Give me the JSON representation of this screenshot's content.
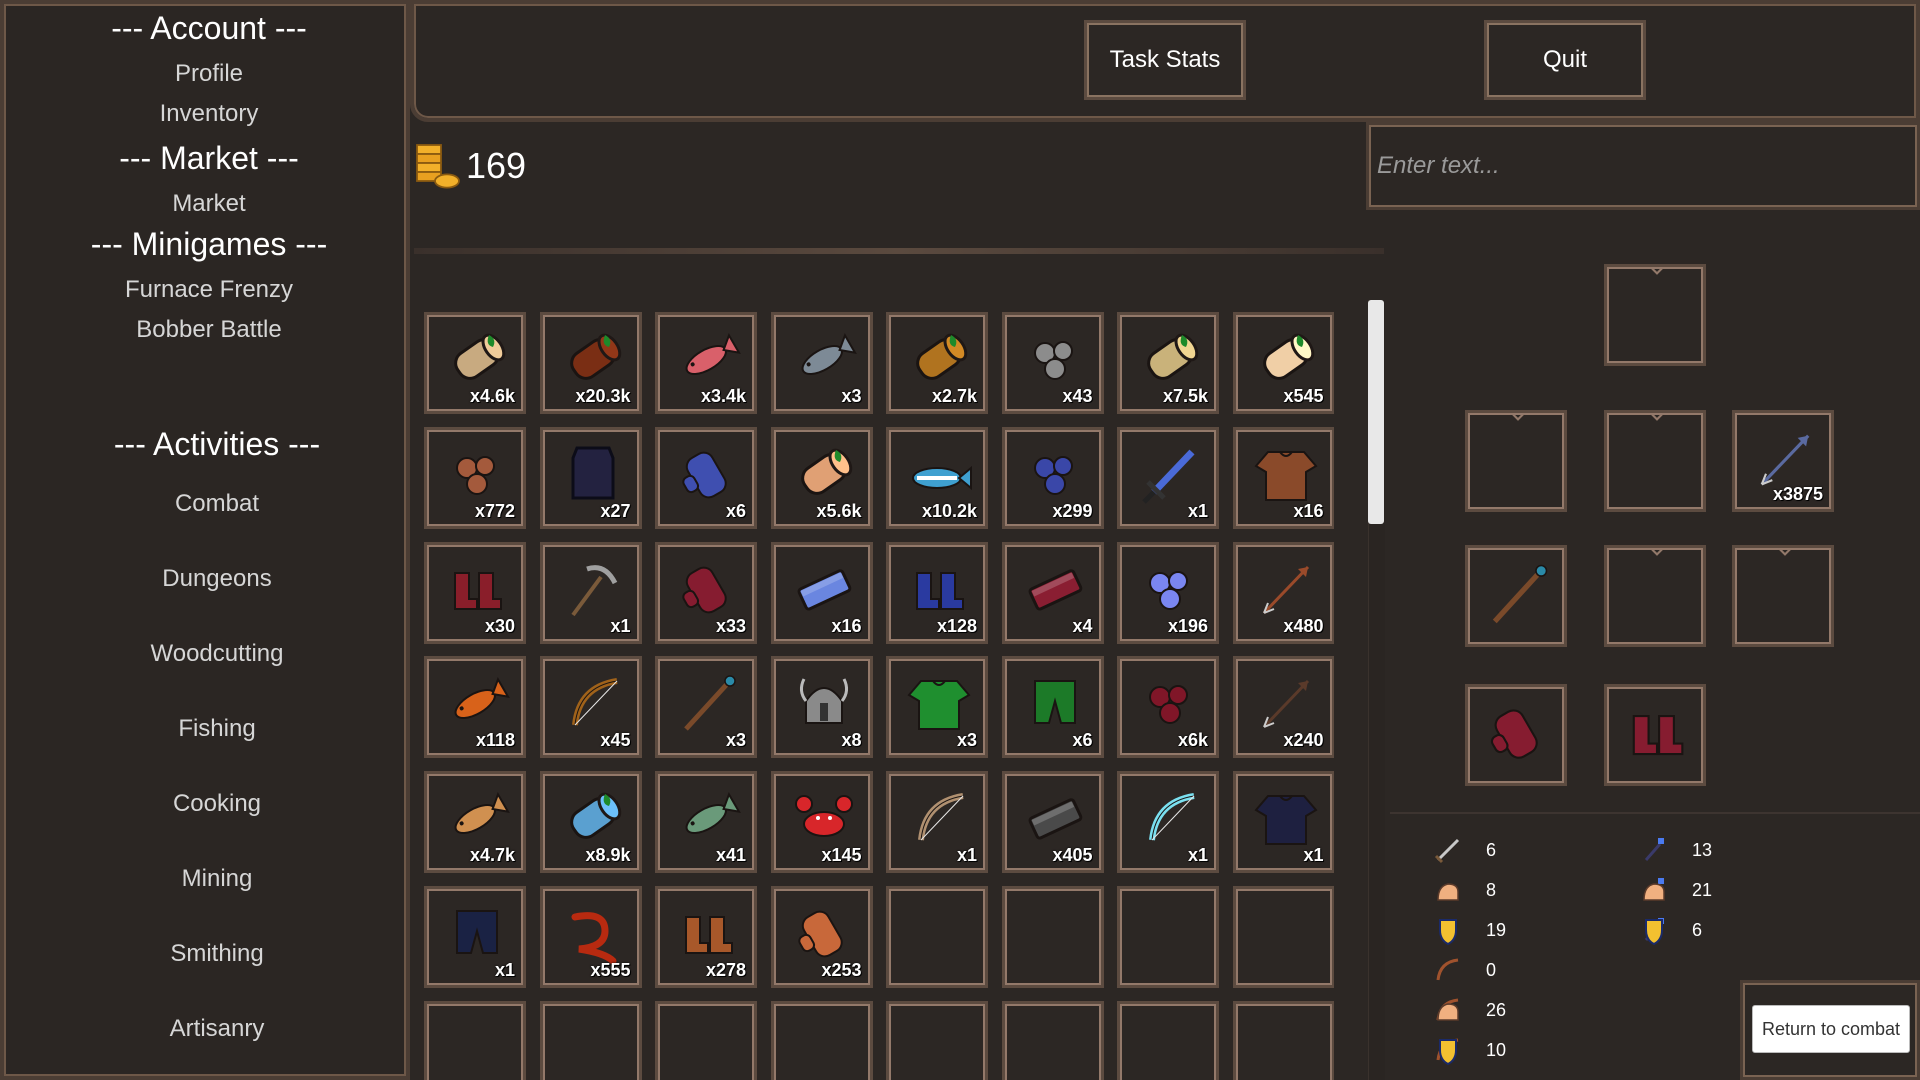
{
  "sidebar": {
    "account_header": "--- Account ---",
    "profile": "Profile",
    "inventory": "Inventory",
    "market_header": "--- Market ---",
    "market": "Market",
    "minigames_header": "--- Minigames ---",
    "furnace": "Furnace Frenzy",
    "bobber": "Bobber Battle",
    "activities_header": "--- Activities ---",
    "activities": [
      "Combat",
      "Dungeons",
      "Woodcutting",
      "Fishing",
      "Cooking",
      "Mining",
      "Smithing",
      "Artisanry"
    ]
  },
  "topbar": {
    "task_stats": "Task Stats",
    "quit": "Quit"
  },
  "gold": "169",
  "chat_placeholder": "Enter text...",
  "inventory": [
    {
      "icon": "birch-log-icon",
      "qty": "x4.6k",
      "color": "#c8aa80"
    },
    {
      "icon": "mahogany-log-icon",
      "qty": "x20.3k",
      "color": "#7a2e14"
    },
    {
      "icon": "pink-fish-icon",
      "qty": "x3.4k",
      "color": "#d9606a"
    },
    {
      "icon": "grey-fish-icon",
      "qty": "x3",
      "color": "#7d8a96"
    },
    {
      "icon": "oak-log-icon",
      "qty": "x2.7k",
      "color": "#b0731f"
    },
    {
      "icon": "stone-ore-icon",
      "qty": "x43",
      "color": "#8c8c8c"
    },
    {
      "icon": "pale-log-icon",
      "qty": "x7.5k",
      "color": "#c9b27a"
    },
    {
      "icon": "cream-log-icon",
      "qty": "x545",
      "color": "#f0cfa6"
    },
    {
      "icon": "copper-ore-icon",
      "qty": "x772",
      "color": "#a45a3c"
    },
    {
      "icon": "dark-body-armor-icon",
      "qty": "x27",
      "color": "#232240"
    },
    {
      "icon": "blue-gloves-icon",
      "qty": "x6",
      "color": "#3f4fb0"
    },
    {
      "icon": "peach-log-icon",
      "qty": "x5.6k",
      "color": "#e0a074"
    },
    {
      "icon": "striped-fish-icon",
      "qty": "x10.2k",
      "color": "#3fa0d0"
    },
    {
      "icon": "blue-ore-icon",
      "qty": "x299",
      "color": "#3a47a8"
    },
    {
      "icon": "blue-sword-icon",
      "qty": "x1",
      "color": "#4a6ad8"
    },
    {
      "icon": "brown-shirt-icon",
      "qty": "x16",
      "color": "#8a4a2a"
    },
    {
      "icon": "red-boots-icon",
      "qty": "x30",
      "color": "#8a1e2a"
    },
    {
      "icon": "pickaxe-icon",
      "qty": "x1",
      "color": "#a0a0a0"
    },
    {
      "icon": "red-gloves-icon",
      "qty": "x33",
      "color": "#861c30"
    },
    {
      "icon": "blue-bar-icon",
      "qty": "x16",
      "color": "#6a86e0"
    },
    {
      "icon": "blue-boots-icon",
      "qty": "x128",
      "color": "#2a3aa0"
    },
    {
      "icon": "red-bar-icon",
      "qty": "x4",
      "color": "#8a1e32"
    },
    {
      "icon": "light-blue-ore-icon",
      "qty": "x196",
      "color": "#7a86f0"
    },
    {
      "icon": "arrow-icon",
      "qty": "x480",
      "color": "#9a4a2a"
    },
    {
      "icon": "orange-fish-icon",
      "qty": "x118",
      "color": "#d8621a"
    },
    {
      "icon": "wooden-bow-icon",
      "qty": "x45",
      "color": "#a0621a"
    },
    {
      "icon": "staff-icon",
      "qty": "x3",
      "color": "#7a4a2a"
    },
    {
      "icon": "horned-helmet-icon",
      "qty": "x8",
      "color": "#8a8a8a"
    },
    {
      "icon": "green-shirt-icon",
      "qty": "x3",
      "color": "#1f8f2f"
    },
    {
      "icon": "green-pants-icon",
      "qty": "x6",
      "color": "#1c7a28"
    },
    {
      "icon": "red-ore-icon",
      "qty": "x6k",
      "color": "#801628"
    },
    {
      "icon": "dark-arrow-icon",
      "qty": "x240",
      "color": "#5a3a2a"
    },
    {
      "icon": "golden-fish-icon",
      "qty": "x4.7k",
      "color": "#d09050"
    },
    {
      "icon": "blue-log-icon",
      "qty": "x8.9k",
      "color": "#5aa0d0"
    },
    {
      "icon": "green-fish-icon",
      "qty": "x41",
      "color": "#6a9a7a"
    },
    {
      "icon": "crab-icon",
      "qty": "x145",
      "color": "#d8262a"
    },
    {
      "icon": "tan-bow-icon",
      "qty": "x1",
      "color": "#b09070"
    },
    {
      "icon": "coal-bar-icon",
      "qty": "x405",
      "color": "#4a4a4a"
    },
    {
      "icon": "ice-bow-icon",
      "qty": "x1",
      "color": "#7ae0f0"
    },
    {
      "icon": "dark-shirt-icon",
      "qty": "x1",
      "color": "#1e2040"
    },
    {
      "icon": "dark-pants-icon",
      "qty": "x1",
      "color": "#1a2244"
    },
    {
      "icon": "eel-icon",
      "qty": "x555",
      "color": "#b82a10"
    },
    {
      "icon": "leather-boots-icon",
      "qty": "x278",
      "color": "#a8582a"
    },
    {
      "icon": "leather-gloves-icon",
      "qty": "x253",
      "color": "#c8683a"
    },
    {
      "icon": "",
      "qty": "",
      "color": ""
    },
    {
      "icon": "",
      "qty": "",
      "color": ""
    },
    {
      "icon": "",
      "qty": "",
      "color": ""
    },
    {
      "icon": "",
      "qty": "",
      "color": ""
    },
    {
      "icon": "",
      "qty": "",
      "color": ""
    },
    {
      "icon": "",
      "qty": "",
      "color": ""
    },
    {
      "icon": "",
      "qty": "",
      "color": ""
    },
    {
      "icon": "",
      "qty": "",
      "color": ""
    },
    {
      "icon": "",
      "qty": "",
      "color": ""
    },
    {
      "icon": "",
      "qty": "",
      "color": ""
    },
    {
      "icon": "",
      "qty": "",
      "color": ""
    },
    {
      "icon": "",
      "qty": "",
      "color": ""
    }
  ],
  "equipment": [
    {
      "slot": "head",
      "icon": "",
      "qty": ""
    },
    {
      "slot": "cape",
      "icon": "",
      "qty": ""
    },
    {
      "slot": "neck",
      "icon": "",
      "qty": ""
    },
    {
      "slot": "ammo",
      "icon": "arrow-icon",
      "qty": "x3875"
    },
    {
      "slot": "weapon",
      "icon": "staff-icon",
      "qty": ""
    },
    {
      "slot": "body",
      "icon": "",
      "qty": ""
    },
    {
      "slot": "shield",
      "icon": "",
      "qty": ""
    },
    {
      "slot": "hands",
      "icon": "red-gloves-icon",
      "qty": ""
    },
    {
      "slot": "feet",
      "icon": "red-boots-icon",
      "qty": ""
    }
  ],
  "stats": [
    {
      "icon": "melee-attack-icon",
      "value": "6"
    },
    {
      "icon": "melee-strength-icon",
      "value": "8"
    },
    {
      "icon": "melee-defence-icon",
      "value": "19"
    },
    {
      "icon": "ranged-attack-icon",
      "value": "0"
    },
    {
      "icon": "ranged-strength-icon",
      "value": "26"
    },
    {
      "icon": "ranged-defence-icon",
      "value": "10"
    },
    {
      "icon": "magic-attack-icon",
      "value": "13"
    },
    {
      "icon": "magic-strength-icon",
      "value": "21"
    },
    {
      "icon": "magic-defence-icon",
      "value": "6"
    }
  ],
  "return_button": "Return to combat"
}
